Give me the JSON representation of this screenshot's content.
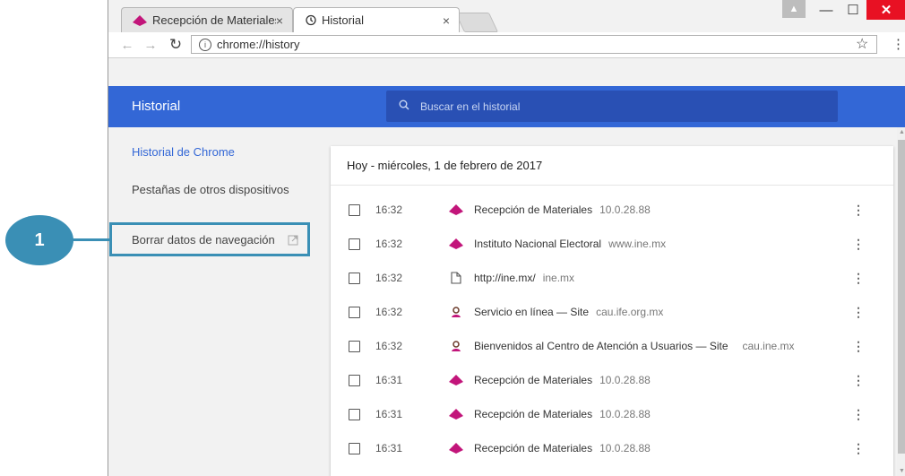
{
  "tabs": [
    {
      "label": "Recepción de Materiales",
      "icon": "ine-logo-icon",
      "active": false
    },
    {
      "label": "Historial",
      "icon": "history-icon",
      "active": true
    }
  ],
  "toolbar": {
    "url": "chrome://history"
  },
  "header": {
    "title": "Historial",
    "search_placeholder": "Buscar en el historial"
  },
  "sidebar": {
    "items": [
      {
        "label": "Historial de Chrome",
        "selected": true
      },
      {
        "label": "Pestañas de otros dispositivos",
        "selected": false
      },
      {
        "label": "Borrar datos de navegación",
        "selected": false
      }
    ]
  },
  "history": {
    "date_header": "Hoy - miércoles, 1 de febrero de 2017",
    "entries": [
      {
        "time": "16:32",
        "title": "Recepción de Materiales",
        "domain": "10.0.28.88",
        "icon": "ine-logo-icon"
      },
      {
        "time": "16:32",
        "title": "Instituto Nacional Electoral",
        "domain": "www.ine.mx",
        "icon": "ine-logo-icon"
      },
      {
        "time": "16:32",
        "title": "http://ine.mx/",
        "domain": "ine.mx",
        "icon": "page-icon"
      },
      {
        "time": "16:32",
        "title": "Servicio en línea — Site",
        "domain": "cau.ife.org.mx",
        "icon": "support-icon"
      },
      {
        "time": "16:32",
        "title": "Bienvenidos al Centro de Atención a Usuarios — Site",
        "domain": "cau.ine.mx",
        "icon": "support-icon"
      },
      {
        "time": "16:31",
        "title": "Recepción de Materiales",
        "domain": "10.0.28.88",
        "icon": "ine-logo-icon"
      },
      {
        "time": "16:31",
        "title": "Recepción de Materiales",
        "domain": "10.0.28.88",
        "icon": "ine-logo-icon"
      },
      {
        "time": "16:31",
        "title": "Recepción de Materiales",
        "domain": "10.0.28.88",
        "icon": "ine-logo-icon"
      }
    ]
  },
  "annotation": {
    "number": "1"
  },
  "colors": {
    "accent": "#3367d6",
    "ine_magenta": "#c2157a",
    "callout": "#3a8fb5"
  }
}
